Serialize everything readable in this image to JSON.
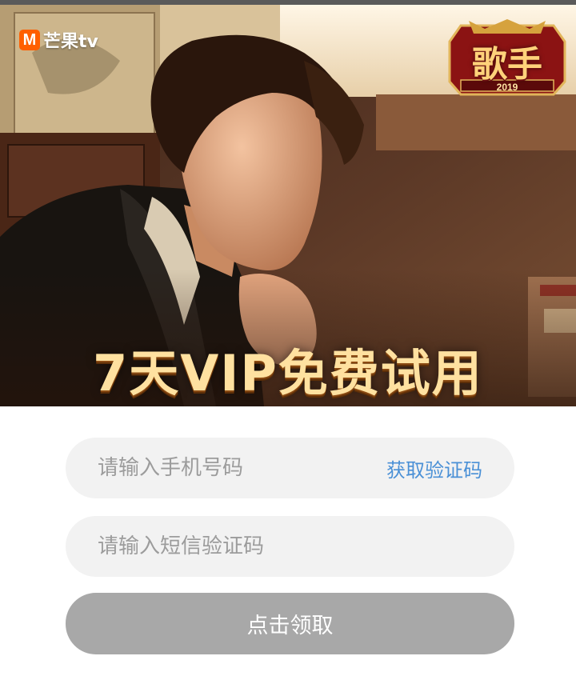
{
  "header": {
    "brand_icon_letter": "M",
    "brand_name": "芒果tv",
    "show_logo_text": "歌手",
    "show_logo_year": "2019",
    "accent_color": "#ff5f00"
  },
  "banner": {
    "headline": "7天VIP免费试用",
    "headline_color": "#ffe1a0"
  },
  "form": {
    "phone_placeholder": "请输入手机号码",
    "phone_value": "",
    "get_code_label": "获取验证码",
    "get_code_color": "#4a90d6",
    "code_placeholder": "请输入短信验证码",
    "code_value": "",
    "submit_label": "点击领取",
    "submit_color": "#a8a8a8"
  }
}
